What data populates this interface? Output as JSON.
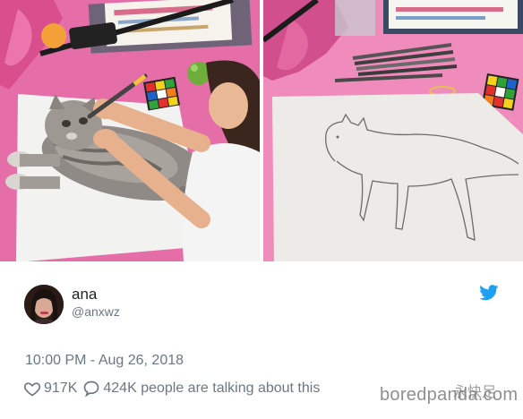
{
  "tweet": {
    "display_name": "ana",
    "handle": "@anxwz",
    "timestamp": "10:00 PM - Aug 26, 2018",
    "likes": "917K",
    "replies": "424K people are talking about this"
  },
  "watermark": {
    "text": "boredpanda.com",
    "cn_text": "永快足"
  },
  "icons": {
    "brand": "twitter-bird-icon",
    "like": "heart-icon",
    "reply": "speech-bubble-icon"
  },
  "colors": {
    "twitter_blue": "#1da1f2",
    "text_primary": "#1c2022",
    "text_secondary": "#697882"
  }
}
